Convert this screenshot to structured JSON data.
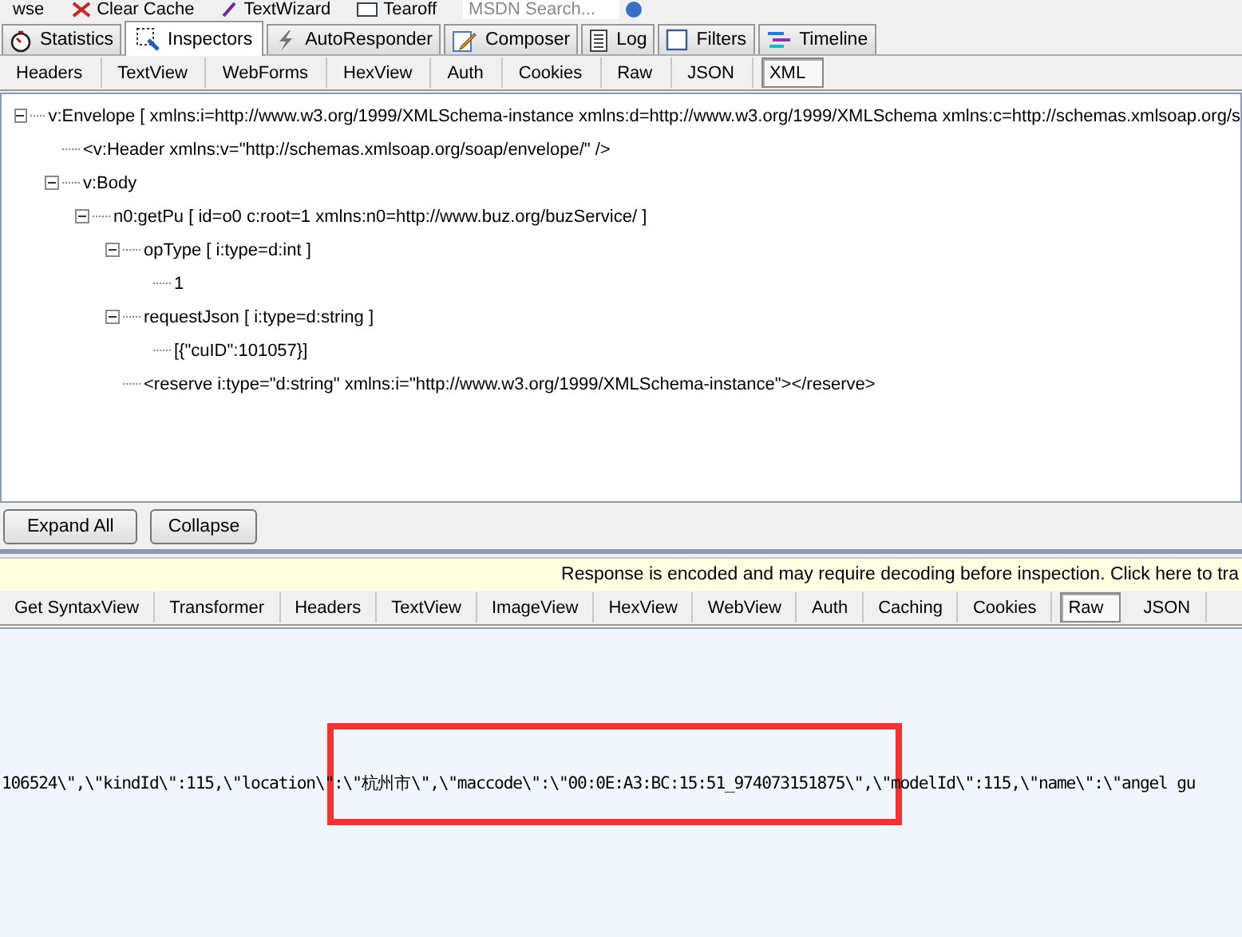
{
  "toolbar": [
    {
      "label": "wse",
      "kind": "plain"
    },
    {
      "label": "Clear Cache",
      "kind": "clear"
    },
    {
      "label": "TextWizard",
      "kind": "wizard"
    },
    {
      "label": "Tearoff",
      "kind": "tearoff"
    },
    {
      "label": "MSDN Search...",
      "kind": "search"
    }
  ],
  "main_tabs": [
    {
      "label": "Statistics",
      "kind": "stopwatch",
      "selected": false
    },
    {
      "label": "Inspectors",
      "kind": "inspector",
      "selected": true
    },
    {
      "label": "AutoResponder",
      "kind": "bolt",
      "selected": false
    },
    {
      "label": "Composer",
      "kind": "composer",
      "selected": false
    },
    {
      "label": "Log",
      "kind": "log",
      "selected": false
    },
    {
      "label": "Filters",
      "kind": "filters",
      "selected": false
    },
    {
      "label": "Timeline",
      "kind": "timeline",
      "selected": false
    }
  ],
  "request_tabs": [
    {
      "label": "Headers",
      "selected": false
    },
    {
      "label": "TextView",
      "selected": false
    },
    {
      "label": "WebForms",
      "selected": false
    },
    {
      "label": "HexView",
      "selected": false
    },
    {
      "label": "Auth",
      "selected": false
    },
    {
      "label": "Cookies",
      "selected": false
    },
    {
      "label": "Raw",
      "selected": false
    },
    {
      "label": "JSON",
      "selected": false
    },
    {
      "label": "XML",
      "selected": true
    }
  ],
  "xml_tree": [
    {
      "text": "v:Envelope [ xmlns:i=http://www.w3.org/1999/XMLSchema-instance xmlns:d=http://www.w3.org/1999/XMLSchema xmlns:c=http://schemas.xmlsoap.org/s",
      "expanded": true,
      "children": [
        {
          "text": "<v:Header xmlns:v=\"http://schemas.xmlsoap.org/soap/envelope/\" />"
        },
        {
          "text": "v:Body",
          "expanded": true,
          "children": [
            {
              "text": "n0:getPu [ id=o0 c:root=1 xmlns:n0=http://www.buz.org/buzService/ ]",
              "expanded": true,
              "children": [
                {
                  "text": "opType [ i:type=d:int ]",
                  "expanded": true,
                  "children": [
                    {
                      "text": "1"
                    }
                  ]
                },
                {
                  "text": "requestJson [ i:type=d:string ]",
                  "expanded": true,
                  "children": [
                    {
                      "text": "[{\"cuID\":101057}]"
                    }
                  ]
                },
                {
                  "text": "<reserve i:type=\"d:string\" xmlns:i=\"http://www.w3.org/1999/XMLSchema-instance\"></reserve>"
                }
              ]
            }
          ]
        }
      ]
    }
  ],
  "tree_buttons": [
    "Expand All",
    "Collapse"
  ],
  "notice": "Response is encoded and may require decoding before inspection. Click here to tra",
  "response_tabs": [
    {
      "label": "Get SyntaxView",
      "selected": false
    },
    {
      "label": "Transformer",
      "selected": false
    },
    {
      "label": "Headers",
      "selected": false
    },
    {
      "label": "TextView",
      "selected": false
    },
    {
      "label": "ImageView",
      "selected": false
    },
    {
      "label": "HexView",
      "selected": false
    },
    {
      "label": "WebView",
      "selected": false
    },
    {
      "label": "Auth",
      "selected": false
    },
    {
      "label": "Caching",
      "selected": false
    },
    {
      "label": "Cookies",
      "selected": false
    },
    {
      "label": "Raw",
      "selected": true
    },
    {
      "label": "JSON",
      "selected": false
    }
  ],
  "raw_text": "106524\\\",\\\"kindId\\\":115,\\\"location\\\":\\\"杭州市\\\",\\\"maccode\\\":\\\"00:0E:A3:BC:15:51_974073151875\\\",\\\"modelId\\\":115,\\\"name\\\":\\\"angel gu"
}
